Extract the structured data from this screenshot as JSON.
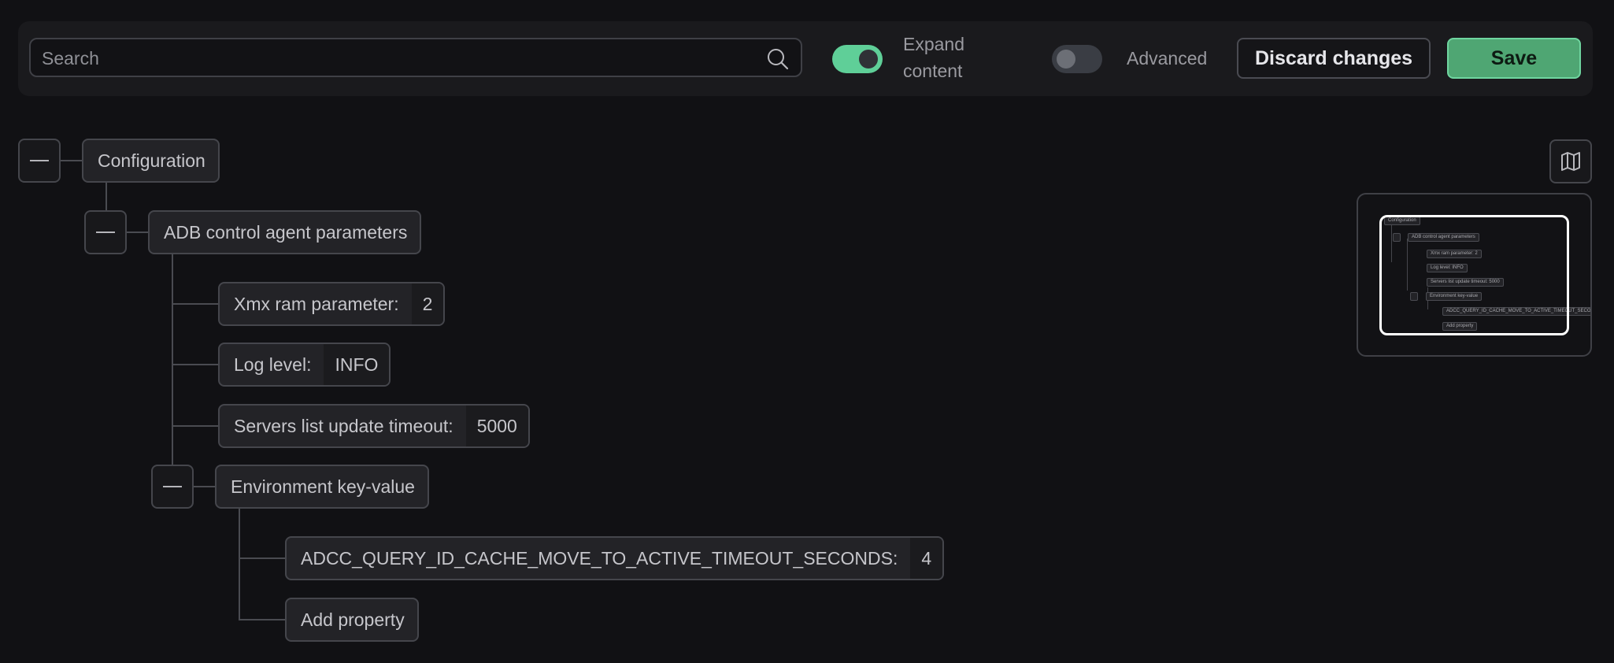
{
  "toolbar": {
    "search": {
      "placeholder": "Search",
      "value": ""
    },
    "expand_content": {
      "label_line1": "Expand",
      "label_line2": "content",
      "on": true
    },
    "advanced": {
      "label": "Advanced",
      "on": false
    },
    "discard_label": "Discard changes",
    "save_label": "Save"
  },
  "tree": {
    "root": {
      "label": "Configuration"
    },
    "section": {
      "label": "ADB control agent parameters"
    },
    "params": [
      {
        "label": "Xmx ram parameter:",
        "value": "2"
      },
      {
        "label": "Log level:",
        "value": "INFO"
      },
      {
        "label": "Servers list update timeout:",
        "value": "5000"
      }
    ],
    "env": {
      "label": "Environment key-value",
      "properties": [
        {
          "label": "ADCC_QUERY_ID_CACHE_MOVE_TO_ACTIVE_TIMEOUT_SECONDS:",
          "value": "4"
        }
      ],
      "add_label": "Add property"
    }
  },
  "minimap": {
    "root": "Configuration",
    "section": "ADB control agent parameters",
    "params": [
      "Xmx ram parameter:",
      "Log level:",
      "Servers list update timeout:"
    ],
    "param_values": [
      "2",
      "INFO",
      "5000"
    ],
    "env": "Environment key-value",
    "property": "ADCC_QUERY_ID_CACHE_MOVE_TO_ACTIVE_TIMEOUT_SECONDS:",
    "add": "Add property"
  },
  "colors": {
    "accent": "#5fcf98",
    "save": "#4fa673",
    "background": "#111114"
  }
}
